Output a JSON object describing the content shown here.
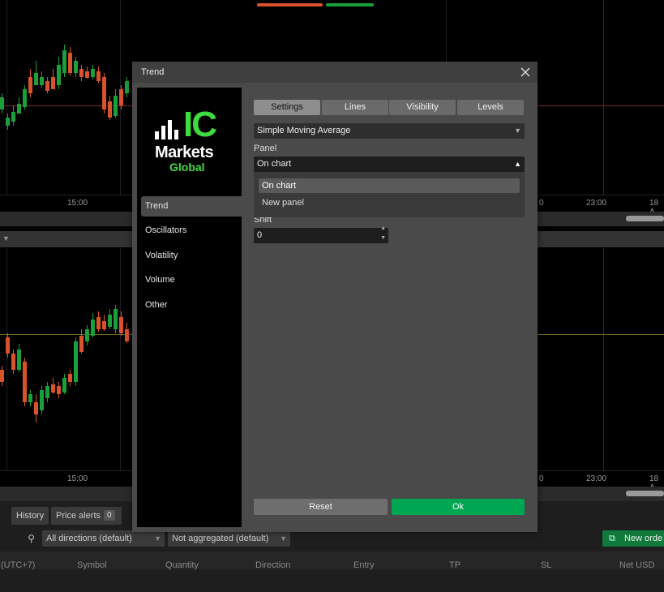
{
  "colors": {
    "up": "#1a9f3a",
    "down": "#d8522c",
    "accent_green": "#00a651",
    "grid": "#1f1f1f"
  },
  "chart_top": {
    "time_labels": [
      "15:00",
      "23:00",
      "18 A"
    ],
    "partial_label": "0"
  },
  "chart_bottom": {
    "time_labels": [
      "15:00",
      "23:00",
      "18 A"
    ],
    "partial_label": "0"
  },
  "bottom_panel": {
    "tabs": [
      {
        "label": "History"
      },
      {
        "label": "Price alerts",
        "badge": "0"
      }
    ],
    "filters": {
      "direction": "All directions (default)",
      "aggregation": "Not aggregated (default)"
    },
    "new_order_label": "New orde",
    "timezone_label": "(UTC+7)",
    "columns": [
      "Symbol",
      "Quantity",
      "Direction",
      "Entry",
      "TP",
      "SL",
      "Net USD"
    ]
  },
  "dialog": {
    "title": "Trend",
    "logo": {
      "line1": "IC",
      "line2": "Markets",
      "line3": "Global"
    },
    "nav": [
      "Trend",
      "Oscillators",
      "Volatility",
      "Volume",
      "Other"
    ],
    "active_nav": "Trend",
    "tabs": [
      "Settings",
      "Lines",
      "Visibility",
      "Levels"
    ],
    "active_tab": "Settings",
    "indicator_value": "Simple Moving Average",
    "panel_label": "Panel",
    "panel_value": "On chart",
    "panel_options": [
      "On chart",
      "New panel"
    ],
    "shift_label": "Shift",
    "shift_value": "0",
    "reset_label": "Reset",
    "ok_label": "Ok"
  }
}
